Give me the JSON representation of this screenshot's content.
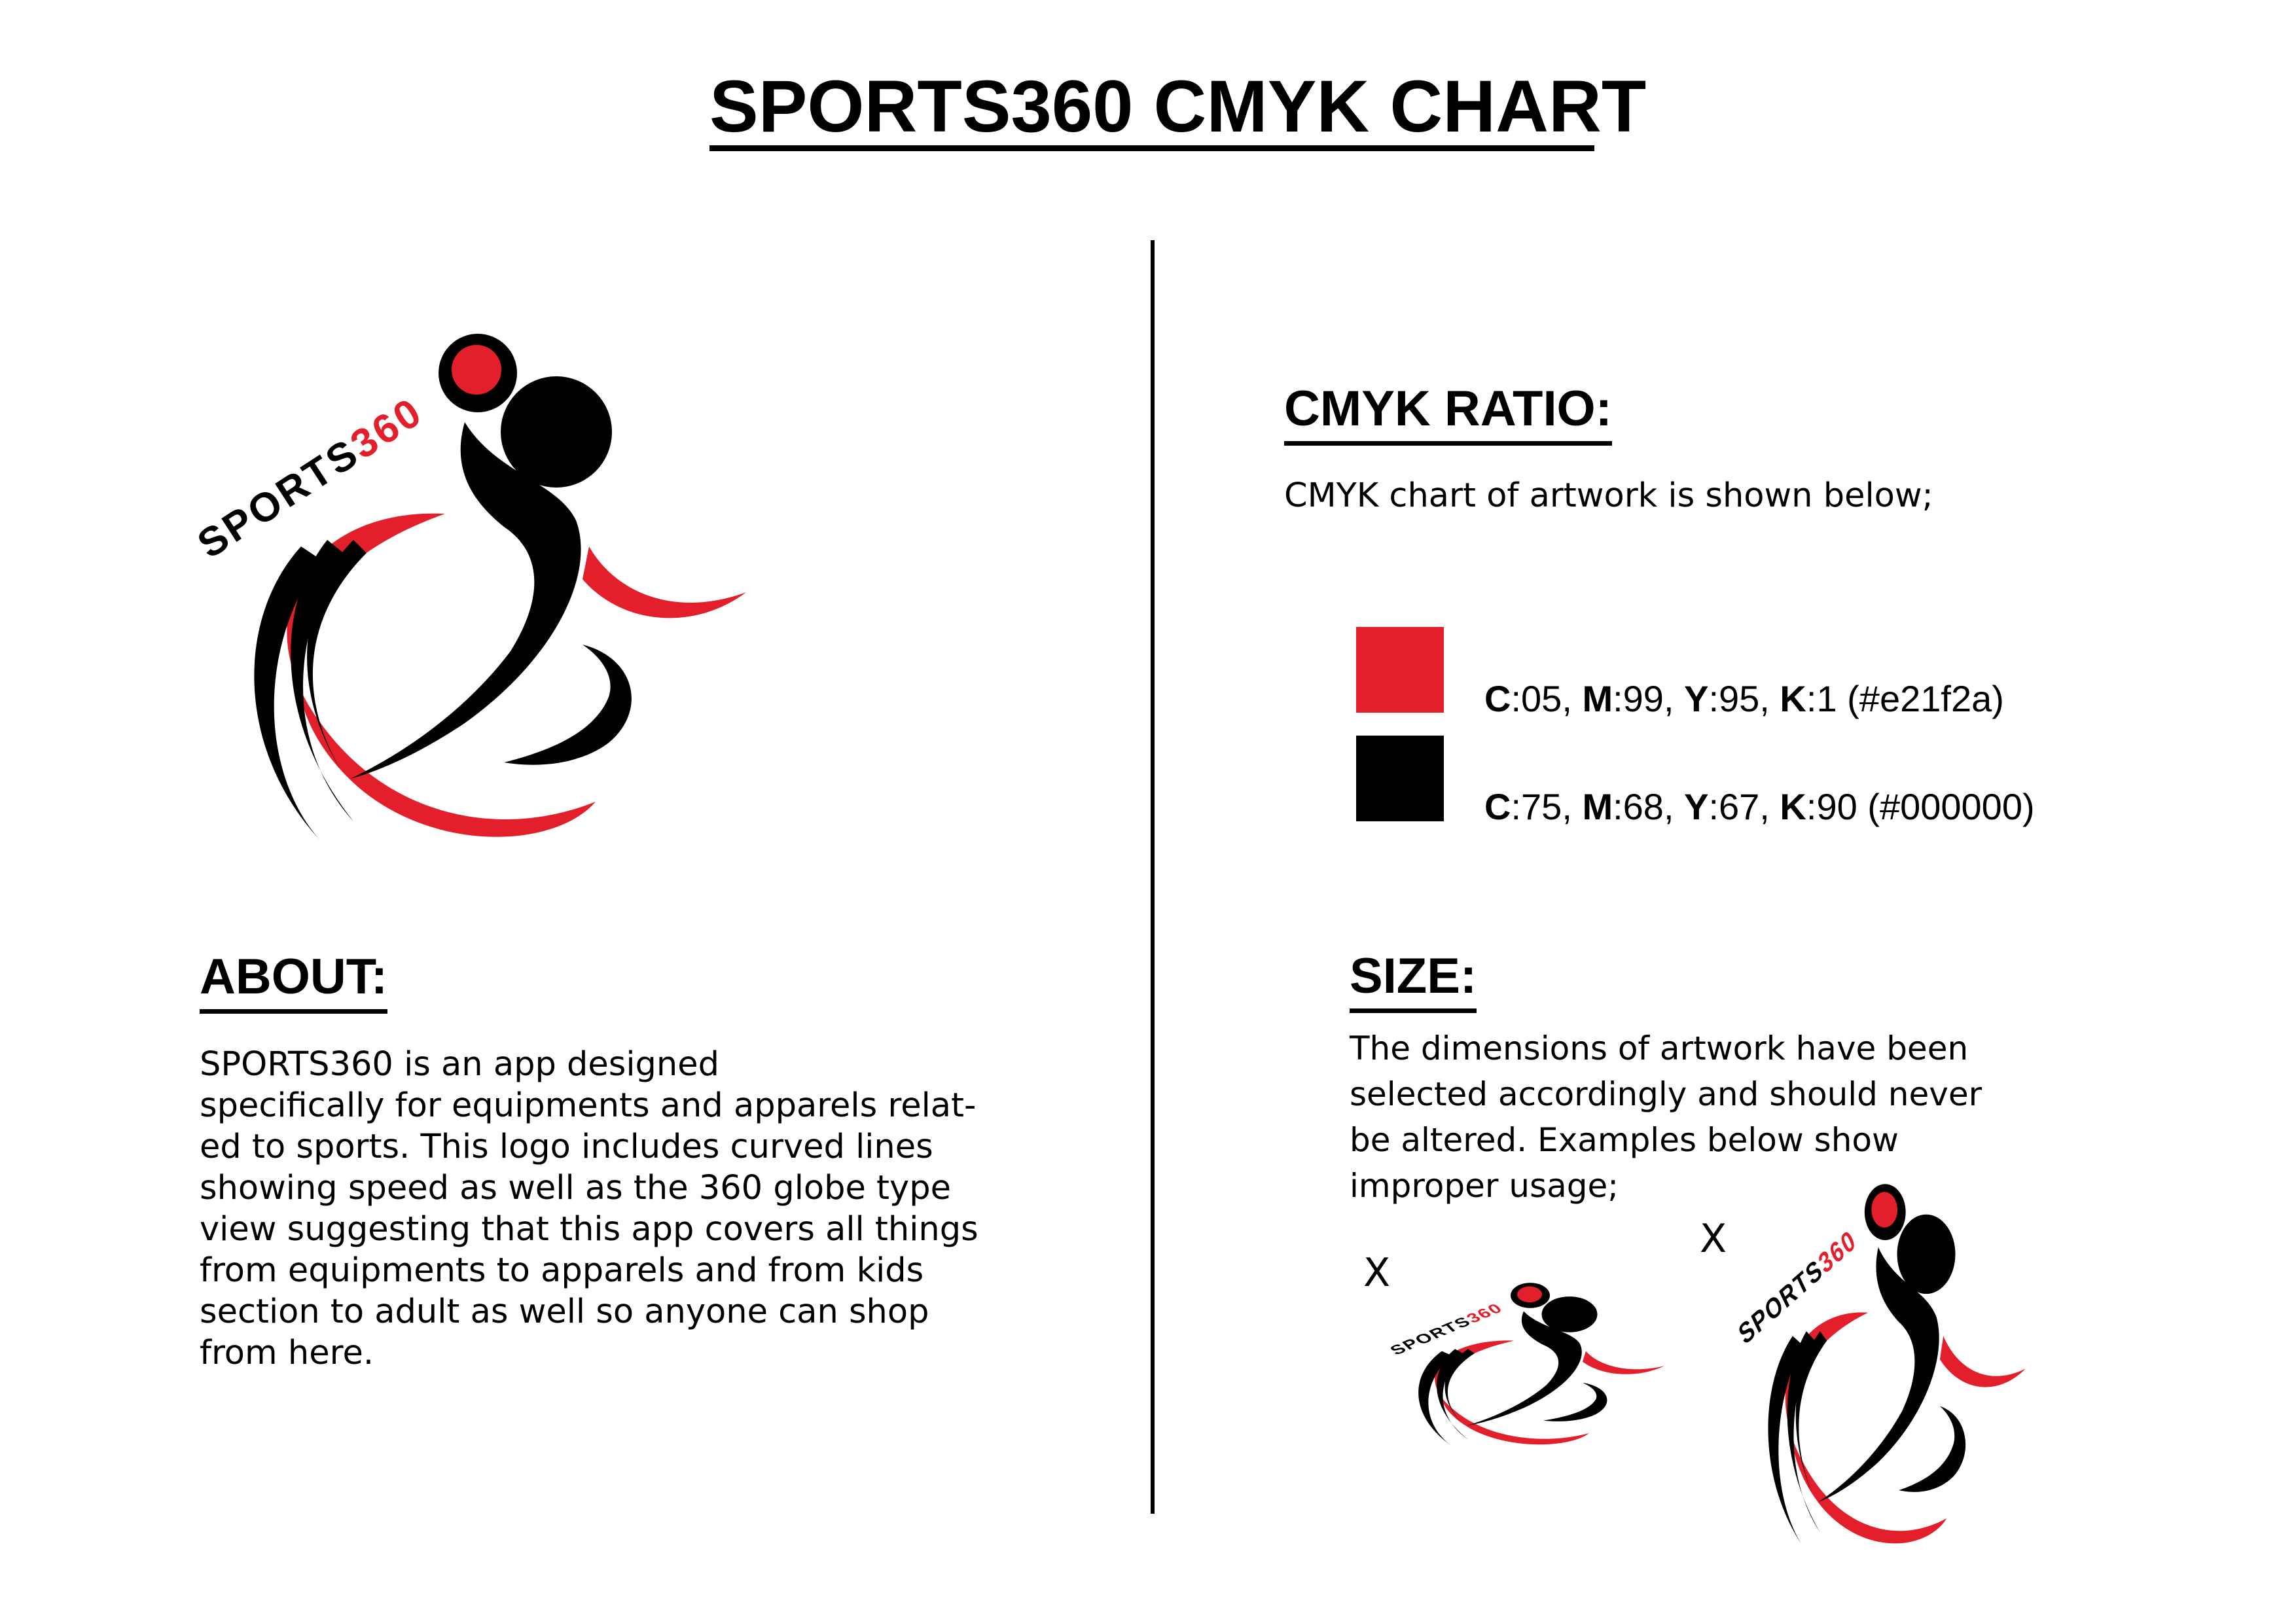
{
  "title": "SPORTS360 CMYK CHART",
  "logo": {
    "wordmark_prefix": "SPORTS",
    "wordmark_suffix": "360",
    "colors": {
      "red": "#e21f2a",
      "black": "#000000"
    }
  },
  "about": {
    "heading": "ABOUT:",
    "text": "SPORTS360 is an app designed\nspecifically for equipments and apparels relat-\ned to sports. This logo includes curved lines\nshowing speed as well as the 360 globe type\nview suggesting that this app covers all things\nfrom equipments to apparels and from kids\nsection to adult as well so anyone can shop\nfrom here."
  },
  "cmyk": {
    "heading": "CMYK RATIO:",
    "intro": "CMYK chart of artwork is shown below;",
    "swatches": [
      {
        "color": "#e21f2a",
        "c": "05",
        "m": "99",
        "y": "95",
        "k": "1",
        "hex": "(#e21f2a)"
      },
      {
        "color": "#000000",
        "c": "75",
        "m": "68",
        "y": "67",
        "k": "90",
        "hex": "(#000000)"
      }
    ]
  },
  "size": {
    "heading": "SIZE:",
    "text": "The dimensions of artwork have been\nselected accordingly and should never\nbe altered. Examples below show\nimproper usage;",
    "improper_marks": [
      "X",
      "X"
    ]
  }
}
